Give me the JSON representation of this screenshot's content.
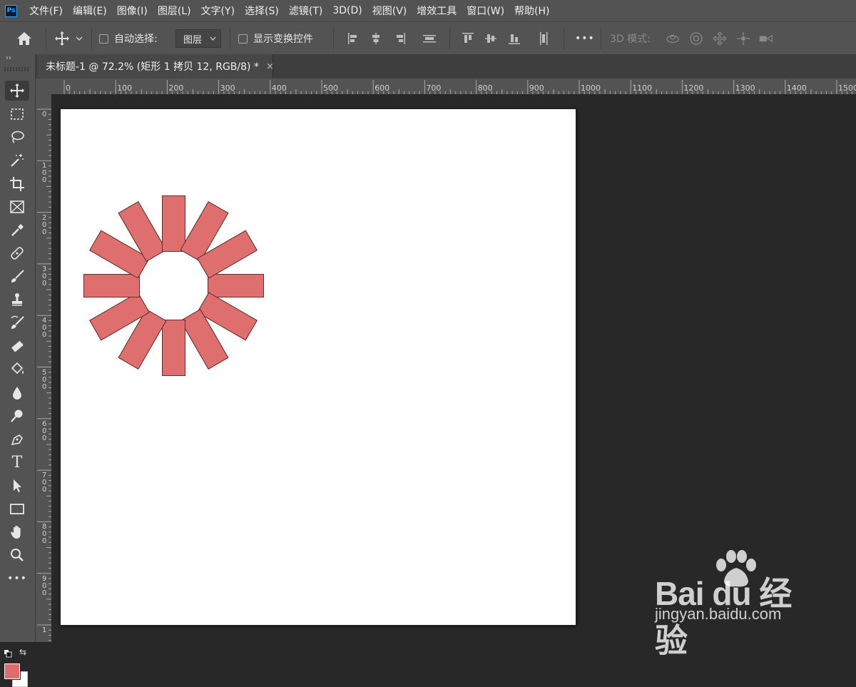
{
  "app": {
    "logo": "Ps"
  },
  "menu": [
    "文件(F)",
    "编辑(E)",
    "图像(I)",
    "图层(L)",
    "文字(Y)",
    "选择(S)",
    "滤镜(T)",
    "3D(D)",
    "视图(V)",
    "增效工具",
    "窗口(W)",
    "帮助(H)"
  ],
  "options": {
    "auto_select_label": "自动选择:",
    "layer_select_value": "图层",
    "show_transform_label": "显示变换控件",
    "more_label": "•••",
    "mode_3d_label": "3D 模式:"
  },
  "document": {
    "tab_title": "未标题-1 @ 72.2% (矩形 1 拷贝 12, RGB/8) *",
    "close_glyph": "×"
  },
  "rulers": {
    "horizontal": [
      "0",
      "100",
      "200",
      "300",
      "400",
      "500",
      "600",
      "700",
      "800",
      "900",
      "1000",
      "1100",
      "1200",
      "1300",
      "1400",
      "1500"
    ],
    "vertical": [
      "0",
      "100",
      "200",
      "300",
      "400",
      "500",
      "600",
      "700",
      "800",
      "900",
      "1"
    ]
  },
  "tools": [
    {
      "name": "move-tool-icon",
      "active": true
    },
    {
      "name": "marquee-tool-icon"
    },
    {
      "name": "lasso-tool-icon"
    },
    {
      "name": "magic-wand-tool-icon"
    },
    {
      "name": "crop-tool-icon"
    },
    {
      "name": "frame-tool-icon"
    },
    {
      "name": "eyedropper-tool-icon"
    },
    {
      "name": "healing-brush-tool-icon"
    },
    {
      "name": "brush-tool-icon"
    },
    {
      "name": "clone-stamp-tool-icon"
    },
    {
      "name": "history-brush-tool-icon"
    },
    {
      "name": "eraser-tool-icon"
    },
    {
      "name": "paint-bucket-tool-icon"
    },
    {
      "name": "blur-tool-icon"
    },
    {
      "name": "dodge-tool-icon"
    },
    {
      "name": "pen-tool-icon"
    },
    {
      "name": "type-tool-icon"
    },
    {
      "name": "path-selection-tool-icon"
    },
    {
      "name": "rectangle-tool-icon"
    },
    {
      "name": "hand-tool-icon"
    },
    {
      "name": "zoom-tool-icon"
    },
    {
      "name": "more-tools-icon"
    }
  ],
  "type_tool_glyph": "T",
  "more_tools_glyph": "•••",
  "colors": {
    "foreground": "#e06d6d",
    "background": "#ffffff",
    "shape_fill": "#df6f6f",
    "shape_stroke": "#5a2f2f"
  },
  "shapes": {
    "type": "rotated-rectangles",
    "count": 12,
    "angle_step_deg": 30
  },
  "watermark": {
    "brand": "Bai du 经验",
    "url": "jingyan.baidu.com"
  }
}
